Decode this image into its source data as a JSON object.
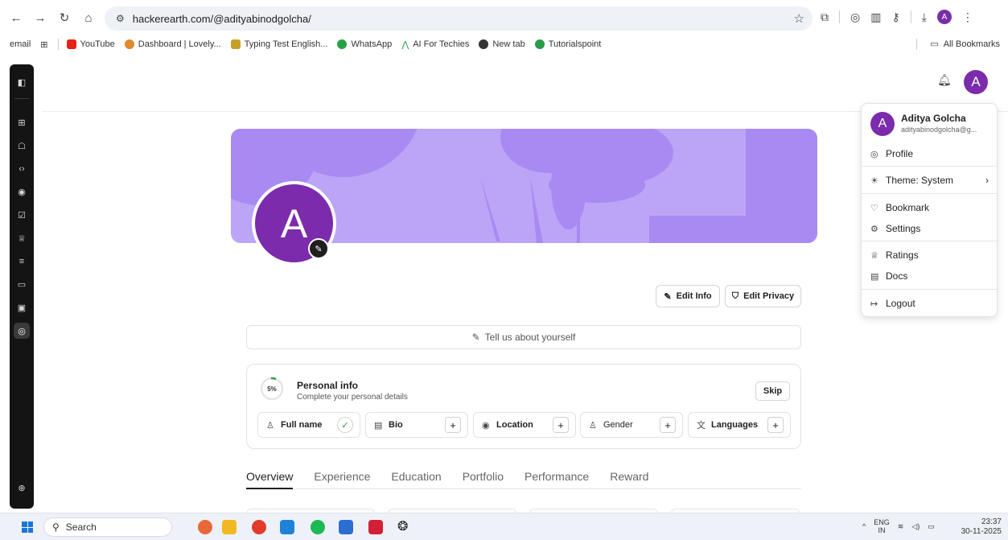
{
  "browser": {
    "url": "hackerearth.com/@adityabinodgolcha/",
    "profile_letter": "A"
  },
  "bookmarks": {
    "items": [
      "email",
      "YouTube",
      "Dashboard | Lovely...",
      "Typing Test English...",
      "WhatsApp",
      "AI For Techies",
      "New tab",
      "Tutorialspoint"
    ],
    "all_label": "All Bookmarks"
  },
  "header": {
    "avatar_letter": "A"
  },
  "profile": {
    "avatar_letter": "A",
    "edit_info": "Edit Info",
    "edit_privacy": "Edit Privacy",
    "about_prompt": "Tell us about yourself"
  },
  "personal_info": {
    "percent_label": "5%",
    "progress_fraction": 0.05,
    "title": "Personal info",
    "subtitle": "Complete your personal details",
    "skip": "Skip",
    "chips": [
      "Full name",
      "Bio",
      "Location",
      "Gender",
      "Languages"
    ]
  },
  "tabs": [
    "Overview",
    "Experience",
    "Education",
    "Portfolio",
    "Performance",
    "Reward"
  ],
  "menu": {
    "avatar_letter": "A",
    "name": "Aditya Golcha",
    "email": "adityabinodgolcha@g...",
    "items": [
      "Profile",
      "Theme: System",
      "Bookmark",
      "Settings",
      "Ratings",
      "Docs",
      "Logout"
    ]
  },
  "taskbar": {
    "search": "Search",
    "lang_top": "ENG",
    "lang_bottom": "IN",
    "time": "23:37",
    "date": "30-11-2025"
  },
  "colors": {
    "brand_purple": "#7b2bab",
    "cover": "#bca4f7",
    "cover_shape": "#a98af2"
  }
}
